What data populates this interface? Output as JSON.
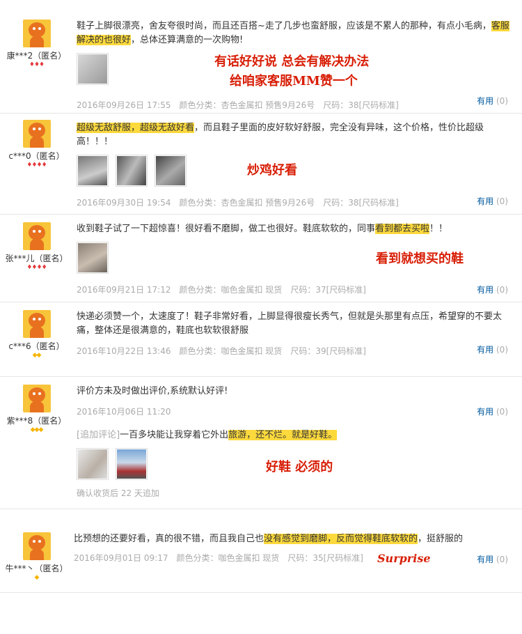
{
  "reviews": [
    {
      "user": "康***2（匿名）",
      "text_a": "鞋子上脚很漂亮，舍友夸很时尚，而且还百搭~走了几步也蛮舒服，应该是不累人的那种，有点小毛病，",
      "text_hl": "客服解决的也很好",
      "text_b": "，总体还算满意的一次购物!",
      "annotation_1": "有话好好说 总会有解决办法",
      "annotation_2": "给咱家客服MM赞一个",
      "date": "2016年09月26日 17:55",
      "color": "颜色分类：杏色金属扣 预售9月26号",
      "size": "尺码：38[尺码标准]",
      "helpful": "有用",
      "count": "(0)"
    },
    {
      "user": "c***0（匿名）",
      "text_hl": "超级无敌舒服，超级无敌好看",
      "text_b": "，而且鞋子里面的皮好软好舒服，完全没有异味，这个价格，性价比超级高！！！",
      "annotation_1": "炒鸡好看",
      "date": "2016年09月30日 19:54",
      "color": "颜色分类：杏色金属扣 预售9月26号",
      "size": "尺码：38[尺码标准]",
      "helpful": "有用",
      "count": "(0)"
    },
    {
      "user": "张***儿（匿名）",
      "text_a": "收到鞋子试了一下超惊喜！很好看不磨脚，做工也很好。鞋底软软的，同事",
      "text_hl": "看到都去买啦",
      "text_b": "！！",
      "annotation_1": "看到就想买的鞋",
      "date": "2016年09月21日 17:12",
      "color": "颜色分类：咖色金属扣 现货",
      "size": "尺码：37[尺码标准]",
      "helpful": "有用",
      "count": "(0)"
    },
    {
      "user": "c***6（匿名）",
      "text_a": "快递必须赞一个，太速度了！鞋子非常好看，上脚显得很瘦长秀气，但就是头那里有点压，希望穿的不要太痛，整体还是很满意的，鞋底也软软很舒服",
      "date": "2016年10月22日 13:46",
      "color": "颜色分类：咖色金属扣 现货",
      "size": "尺码：39[尺码标准]",
      "helpful": "有用",
      "count": "(0)"
    },
    {
      "user": "紫***8（匿名）",
      "text_a": "评价方未及时做出评价,系统默认好评!",
      "date": "2016年10月06日 11:20",
      "helpful": "有用",
      "count": "(0)",
      "followup_tag": "[追加评论]",
      "followup_a": "一百多块能让我穿着它外出",
      "followup_hl": "旅游，还不烂。就是好鞋。",
      "annotation_1": "好鞋 必须的",
      "followup_meta": "确认收货后 22 天追加"
    },
    {
      "user": "牛***丶（匿名）",
      "text_a": "比预想的还要好看，真的很不错，而且我自己也",
      "text_hl": "没有感觉到磨脚，反而觉得鞋底软软的",
      "text_b": "，挺舒服的",
      "annotation_1": "Surprise",
      "date": "2016年09月01日 09:17",
      "color": "颜色分类：咖色金属扣 现货",
      "size": "尺码：35[尺码标准]",
      "helpful": "有用",
      "count": "(0)"
    }
  ],
  "colors": {
    "highlight": "#fcd93d",
    "annotation": "#d81e06",
    "helpful_link": "#005aa0"
  }
}
